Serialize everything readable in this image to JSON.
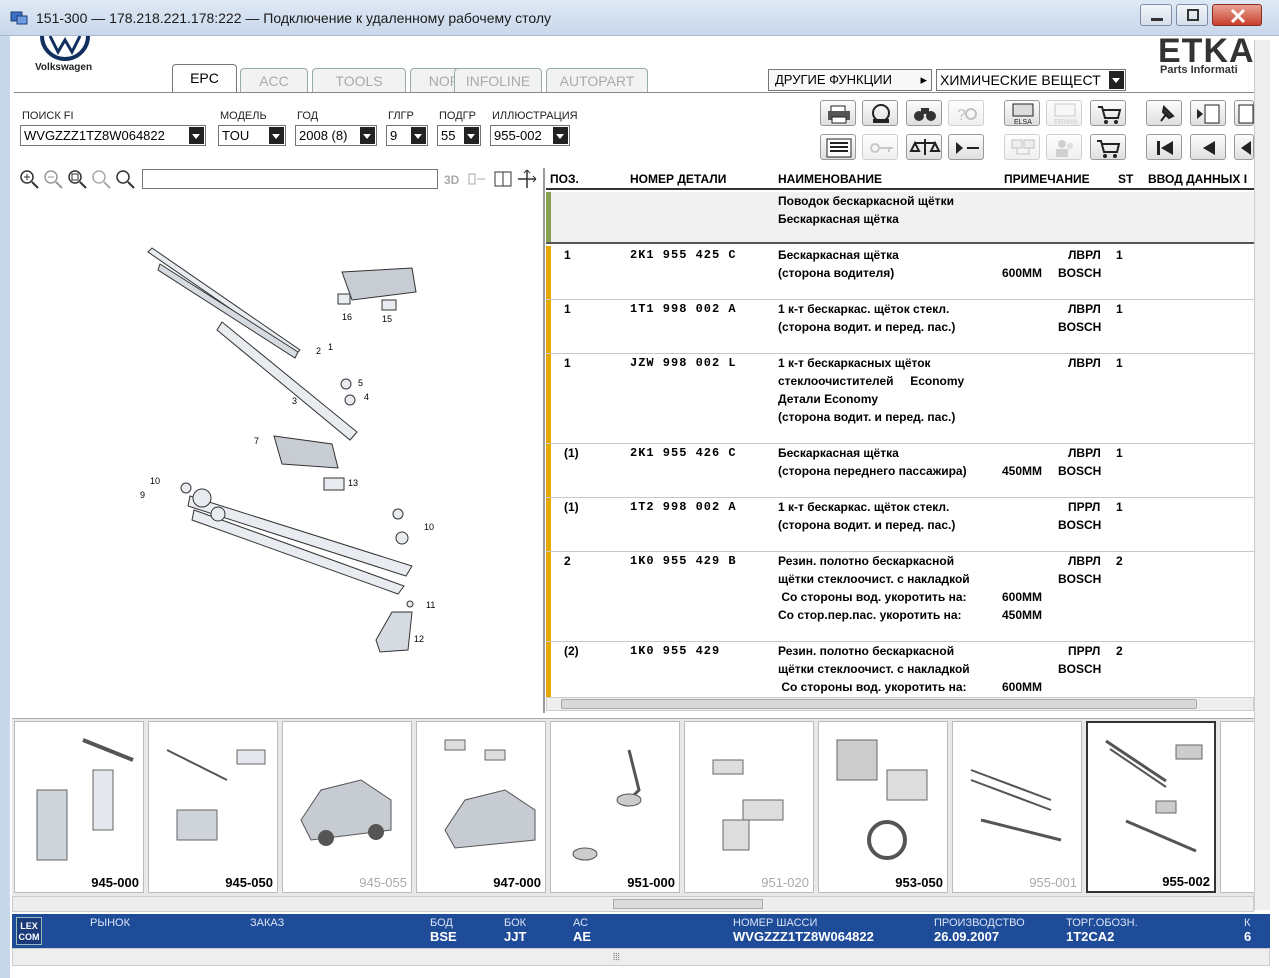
{
  "window": {
    "title": "151-300 — 178.218.221.178:222 — Подключение к удаленному рабочему столу"
  },
  "brand": {
    "left_logo_text": "Volkswagen",
    "right_logo_text": "ETKA",
    "right_logo_sub": "Parts Informati"
  },
  "tabs": [
    {
      "label": "EPC",
      "active": true
    },
    {
      "label": "ACC",
      "active": false
    },
    {
      "label": "TOOLS",
      "active": false
    },
    {
      "label": "NORA",
      "active": false
    },
    {
      "label": "INFOLINE",
      "active": false
    },
    {
      "label": "AUTOPART",
      "active": false
    }
  ],
  "other_functions": {
    "label": "ДРУГИЕ ФУНКЦИИ",
    "selected": "ХИМИЧЕСКИЕ ВЕЩЕСТ"
  },
  "filters": {
    "search_fi": {
      "label": "ПОИСК FI",
      "value": "WVGZZZ1TZ8W064822"
    },
    "model": {
      "label": "МОДЕЛЬ",
      "value": "TOU"
    },
    "year": {
      "label": "ГОД",
      "value": "2008 (8)"
    },
    "glgr": {
      "label": "ГЛГР",
      "value": "9"
    },
    "podgr": {
      "label": "ПОДГР",
      "value": "55"
    },
    "illustration": {
      "label": "ИЛЛЮСТРАЦИЯ",
      "value": "955-002"
    }
  },
  "toolbar": {
    "icons": [
      "print-icon",
      "dealer-icon",
      "binoculars-icon",
      "search-question-icon",
      "elsa-icon",
      "erwin-icon",
      "cart-arrow-icon",
      "pin-icon",
      "book-back-icon",
      "notes-icon",
      "list-icon",
      "key-icon",
      "scale-icon",
      "arrow-minus-icon",
      "network-icon",
      "users-icon",
      "cart-icon",
      "first-page-icon",
      "prev-page-icon",
      "back-icon"
    ],
    "elsa_label": "ELSA",
    "erwin_label": "ERWIN"
  },
  "illustration_toolbar": {
    "label_3d": "3D"
  },
  "table": {
    "columns": [
      "ПОЗ.",
      "НОМЕР ДЕТАЛИ",
      "НАИМЕНОВАНИЕ",
      "ПРИМЕЧАНИЕ",
      "ST",
      "ВВОД ДАННЫХ I"
    ],
    "header_row": {
      "lines": [
        "Поводок бескаркасной щётки",
        "Бескаркасная щётка"
      ]
    },
    "rows": [
      {
        "pos": "1",
        "part": "2K1 955 425 C",
        "name": [
          "Бескаркасная щётка",
          "(сторона водителя)"
        ],
        "note_right": [
          "ЛВРЛ",
          "BOSCH"
        ],
        "note_left": [
          "",
          "600MM"
        ],
        "st": "1"
      },
      {
        "pos": "1",
        "part": "1T1 998 002 A",
        "name": [
          "1 к-т бескаркас. щёток стекл.",
          "(сторона водит. и перед. пас.)"
        ],
        "note_right": [
          "ЛВРЛ",
          "BOSCH"
        ],
        "note_left": [
          "",
          ""
        ],
        "st": "1"
      },
      {
        "pos": "1",
        "part": "JZW 998 002 L",
        "name": [
          "1 к-т бескаркасных щёток",
          "стеклоочистителей     Economy",
          "Детали Economy",
          "(сторона водит. и перед. пас.)"
        ],
        "note_right": [
          "ЛВРЛ"
        ],
        "note_left": [
          ""
        ],
        "st": "1"
      },
      {
        "pos": "(1)",
        "part": "2K1 955 426 C",
        "name": [
          "Бескаркасная щётка",
          "(сторона переднего пассажира)"
        ],
        "note_right": [
          "ЛВРЛ",
          "BOSCH"
        ],
        "note_left": [
          "",
          "450MM"
        ],
        "st": "1"
      },
      {
        "pos": "(1)",
        "part": "1T2 998 002 A",
        "name": [
          "1 к-т бескаркас. щёток стекл.",
          "(сторона водит. и перед. пас.)"
        ],
        "note_right": [
          "ПРРЛ",
          "BOSCH"
        ],
        "note_left": [
          "",
          ""
        ],
        "st": "1"
      },
      {
        "pos": "2",
        "part": "1K0 955 429 B",
        "name": [
          "Резин. полотно бескаркасной",
          "щётки стеклоочист. с накладкой",
          " Со стороны вод. укоротить на:",
          "Со стор.пер.пас. укоротить на:"
        ],
        "note_right": [
          "ЛВРЛ",
          "BOSCH",
          "",
          ""
        ],
        "note_left": [
          "",
          "",
          "600MM",
          "450MM"
        ],
        "st": "2"
      },
      {
        "pos": "(2)",
        "part": "1K0 955 429",
        "name": [
          "Резин. полотно бескаркасной",
          "щётки стеклоочист. с накладкой",
          " Со стороны вод. укоротить на:"
        ],
        "note_right": [
          "ПРРЛ",
          "BOSCH",
          ""
        ],
        "note_left": [
          "",
          "",
          "600MM"
        ],
        "st": "2"
      }
    ]
  },
  "diagram_labels": [
    "1",
    "2",
    "3",
    "4",
    "5",
    "7",
    "9",
    "10",
    "11",
    "12",
    "13",
    "15",
    "16",
    "10"
  ],
  "thumbnails": [
    {
      "label": "945-000",
      "dim": false,
      "selected": false
    },
    {
      "label": "945-050",
      "dim": false,
      "selected": false
    },
    {
      "label": "945-055",
      "dim": true,
      "selected": false
    },
    {
      "label": "947-000",
      "dim": false,
      "selected": false
    },
    {
      "label": "951-000",
      "dim": false,
      "selected": false
    },
    {
      "label": "951-020",
      "dim": true,
      "selected": false
    },
    {
      "label": "953-050",
      "dim": false,
      "selected": false
    },
    {
      "label": "955-001",
      "dim": true,
      "selected": false
    },
    {
      "label": "955-002",
      "dim": false,
      "selected": true
    }
  ],
  "status": {
    "logo": "LEX COM",
    "market_label": "РЫНОК",
    "order_label": "ЗАКАЗ",
    "bod_label": "БОД",
    "bod_value": "BSE",
    "bok_label": "БОК",
    "bok_value": "JJT",
    "ac_label": "АС",
    "ac_value": "AE",
    "chassis_label": "НОМЕР ШАССИ",
    "chassis_value": "WVGZZZ1TZ8W064822",
    "production_label": "ПРОИЗВОДСТВО",
    "production_value": "26.09.2007",
    "trade_label": "ТОРГ.ОБОЗН.",
    "trade_value": "1T2CA2",
    "extra_label": "К",
    "extra_value": "6"
  },
  "colors": {
    "status_bar": "#1f4c99",
    "row_accent": "#e4a800",
    "header_accent": "#8aa052"
  }
}
